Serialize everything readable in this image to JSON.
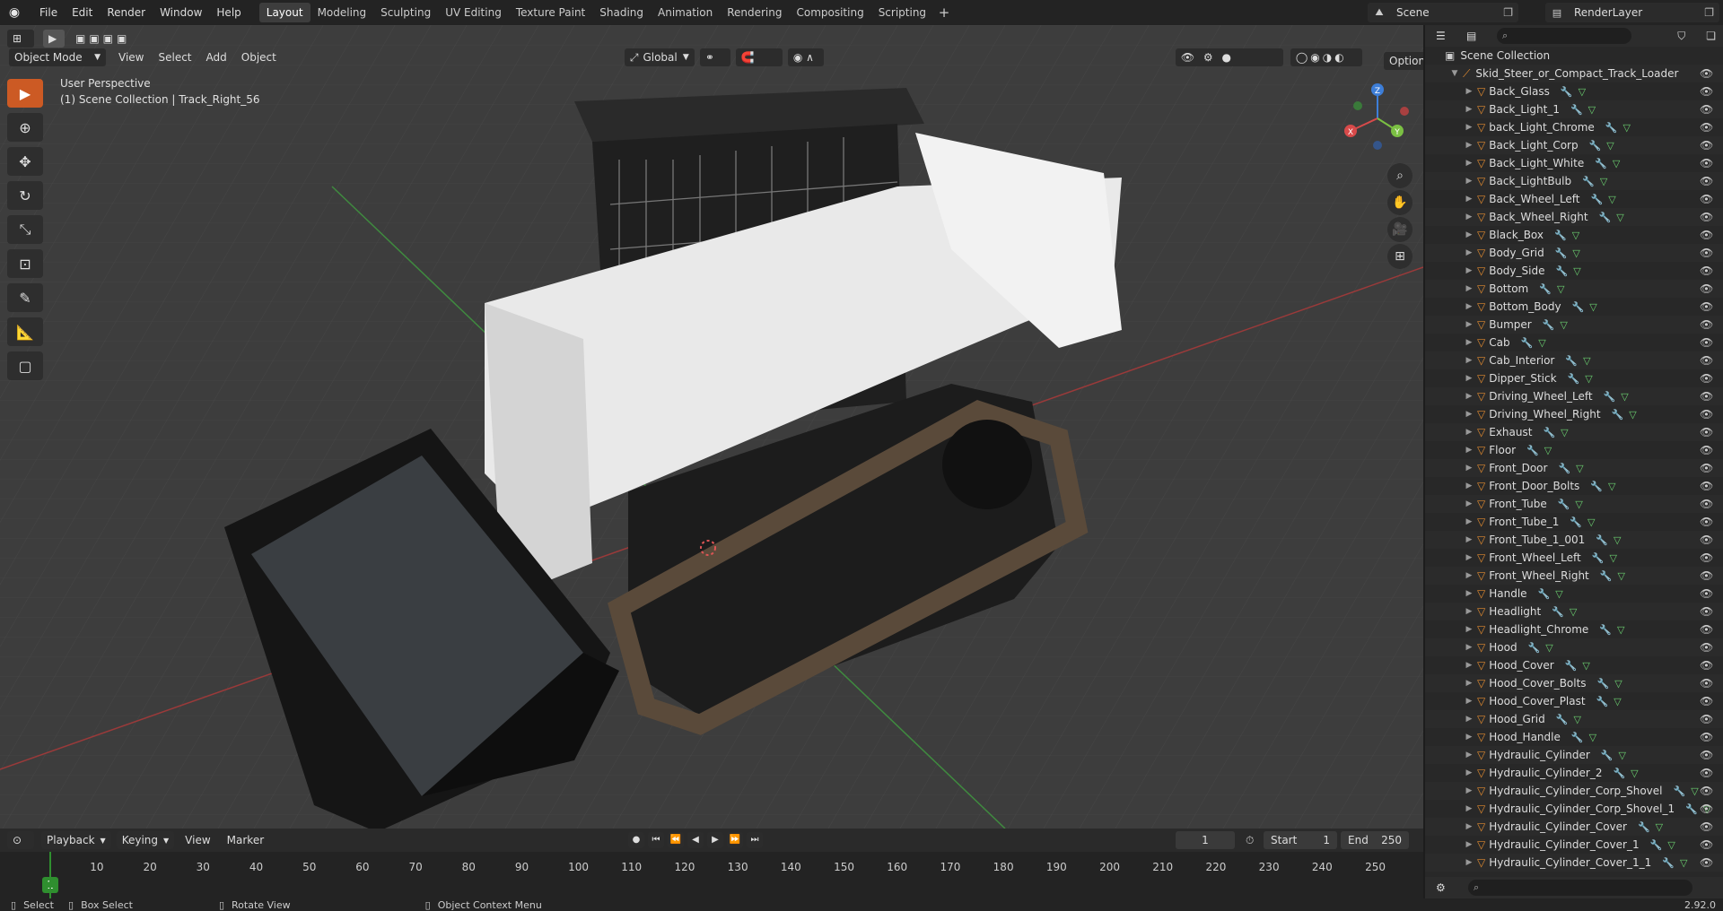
{
  "top_menu": [
    "File",
    "Edit",
    "Render",
    "Window",
    "Help"
  ],
  "workspaces": [
    "Layout",
    "Modeling",
    "Sculpting",
    "UV Editing",
    "Texture Paint",
    "Shading",
    "Animation",
    "Rendering",
    "Compositing",
    "Scripting"
  ],
  "active_workspace": "Layout",
  "scene": "Scene",
  "render_layer": "RenderLayer",
  "viewport": {
    "mode": "Object Mode",
    "menus": [
      "View",
      "Select",
      "Add",
      "Object"
    ],
    "orientation": "Global",
    "options": "Options",
    "perspective": "User Perspective",
    "context": "(1) Scene Collection | Track_Right_56"
  },
  "gizmo_axes": {
    "x": "X",
    "y": "Y",
    "z": "Z"
  },
  "timeline": {
    "menus": [
      "Playback",
      "Keying",
      "View",
      "Marker"
    ],
    "current_frame": "1",
    "start_label": "Start",
    "start": "1",
    "end_label": "End",
    "end": "250",
    "ticks": [
      "10",
      "20",
      "30",
      "40",
      "50",
      "60",
      "70",
      "80",
      "90",
      "100",
      "110",
      "120",
      "130",
      "140",
      "150",
      "160",
      "170",
      "180",
      "190",
      "200",
      "210",
      "220",
      "230",
      "240",
      "250"
    ],
    "current_tick": "1"
  },
  "outliner": {
    "root": "Scene Collection",
    "collection": "Skid_Steer_or_Compact_Track_Loader",
    "items": [
      "Back_Glass",
      "Back_Light_1",
      "back_Light_Chrome",
      "Back_Light_Corp",
      "Back_Light_White",
      "Back_LightBulb",
      "Back_Wheel_Left",
      "Back_Wheel_Right",
      "Black_Box",
      "Body_Grid",
      "Body_Side",
      "Bottom",
      "Bottom_Body",
      "Bumper",
      "Cab",
      "Cab_Interior",
      "Dipper_Stick",
      "Driving_Wheel_Left",
      "Driving_Wheel_Right",
      "Exhaust",
      "Floor",
      "Front_Door",
      "Front_Door_Bolts",
      "Front_Tube",
      "Front_Tube_1",
      "Front_Tube_1_001",
      "Front_Wheel_Left",
      "Front_Wheel_Right",
      "Handle",
      "Headlight",
      "Headlight_Chrome",
      "Hood",
      "Hood_Cover",
      "Hood_Cover_Bolts",
      "Hood_Cover_Plast",
      "Hood_Grid",
      "Hood_Handle",
      "Hydraulic_Cylinder",
      "Hydraulic_Cylinder_2",
      "Hydraulic_Cylinder_Corp_Shovel",
      "Hydraulic_Cylinder_Corp_Shovel_1",
      "Hydraulic_Cylinder_Cover",
      "Hydraulic_Cylinder_Cover_1",
      "Hydraulic_Cylinder_Cover_1_1"
    ]
  },
  "statusbar": {
    "select": "Select",
    "box_select": "Box Select",
    "rotate": "Rotate View",
    "context_menu": "Object Context Menu",
    "version": "2.92.0"
  }
}
